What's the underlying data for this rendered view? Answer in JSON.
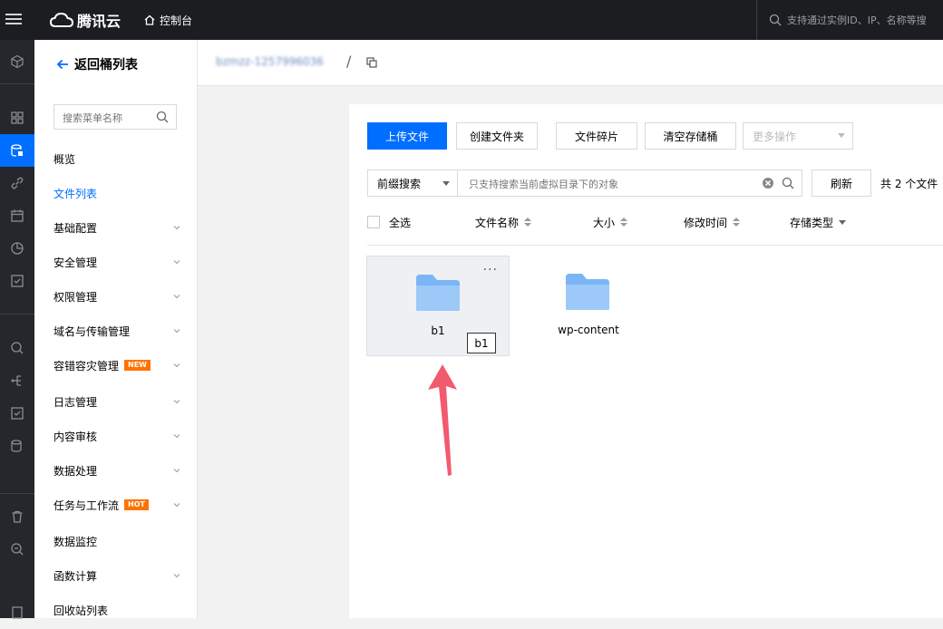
{
  "topbar": {
    "brand": "腾讯云",
    "console_label": "控制台",
    "search_placeholder": "支持通过实例ID、IP、名称等搜"
  },
  "sidemenu": {
    "back_label": "返回桶列表",
    "search_placeholder": "搜索菜单名称",
    "items": [
      {
        "label": "概览"
      },
      {
        "label": "文件列表"
      },
      {
        "label": "基础配置"
      },
      {
        "label": "安全管理"
      },
      {
        "label": "权限管理"
      },
      {
        "label": "域名与传输管理"
      },
      {
        "label": "容错容灾管理",
        "badge": "NEW"
      },
      {
        "label": "日志管理"
      },
      {
        "label": "内容审核"
      },
      {
        "label": "数据处理"
      },
      {
        "label": "任务与工作流",
        "badge": "HOT"
      },
      {
        "label": "数据监控"
      },
      {
        "label": "函数计算"
      },
      {
        "label": "回收站列表"
      }
    ]
  },
  "breadcrumb": {
    "bucket_name": "bzmzz-1257996036",
    "separator": "/"
  },
  "toolbar": {
    "upload": "上传文件",
    "create_folder": "创建文件夹",
    "fragments": "文件碎片",
    "clear_bucket": "清空存储桶",
    "more_actions": "更多操作"
  },
  "filter": {
    "mode": "前缀搜索",
    "placeholder": "只支持搜索当前虚拟目录下的对象",
    "refresh": "刷新",
    "count_text": "共 2 个文件"
  },
  "table_header": {
    "select_all": "全选",
    "file_name": "文件名称",
    "size": "大小",
    "modified": "修改时间",
    "storage_class": "存储类型"
  },
  "files": [
    {
      "name": "b1",
      "more": "···",
      "tooltip": "b1"
    },
    {
      "name": "wp-content"
    }
  ],
  "colors": {
    "accent": "#006eff",
    "topbar": "#1b1d21",
    "rail": "#25272c",
    "badge": "#ff7200",
    "folder": "#7ab6f5",
    "annotation_arrow": "#f25a6e"
  }
}
